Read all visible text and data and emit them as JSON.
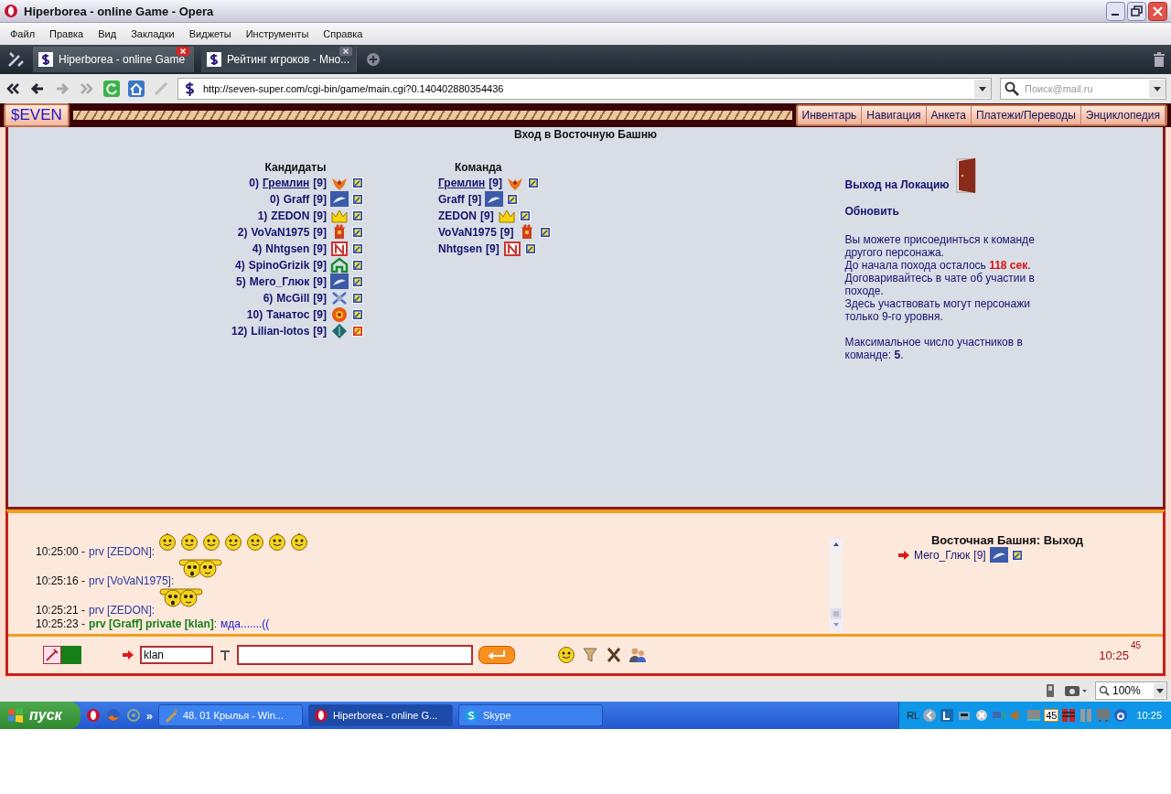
{
  "window": {
    "title": "Hiperborea - online Game - Opera"
  },
  "menu": [
    "Файл",
    "Правка",
    "Вид",
    "Закладки",
    "Виджеты",
    "Инструменты",
    "Справка"
  ],
  "tabs": [
    {
      "title": "Hiperborea - online Game",
      "selected": true
    },
    {
      "title": "Рейтинг игроков - Мно...",
      "selected": false
    }
  ],
  "address": {
    "url": "http://seven-super.com/cgi-bin/game/main.cgi?0.140402880354436"
  },
  "search": {
    "placeholder": "Поиск@mail.ru"
  },
  "game": {
    "logo": "$EVEN",
    "nav": [
      "Инвентарь",
      "Навигация",
      "Анкета",
      "Платежи/Переводы",
      "Энциклопедия"
    ],
    "heading": "Вход в Восточную Башню",
    "candidates": {
      "title": "Кандидаты",
      "rows": [
        {
          "rank": "0)",
          "name": "Гремлин",
          "level": "[9]",
          "link": true,
          "kind": "phoenix",
          "flagged": false
        },
        {
          "rank": "0)",
          "name": "Graff",
          "level": "[9]",
          "link": false,
          "kind": "dolphin",
          "flagged": false
        },
        {
          "rank": "1)",
          "name": "ZEDON",
          "level": "[9]",
          "link": false,
          "kind": "crown",
          "flagged": false
        },
        {
          "rank": "2)",
          "name": "VoVaN1975",
          "level": "[9]",
          "link": false,
          "kind": "tower",
          "flagged": false
        },
        {
          "rank": "4)",
          "name": "Nhtgsen",
          "level": "[9]",
          "link": false,
          "kind": "banner",
          "flagged": false
        },
        {
          "rank": "4)",
          "name": "SpinoGrizik",
          "level": "[9]",
          "link": false,
          "kind": "arch",
          "flagged": false
        },
        {
          "rank": "5)",
          "name": "Мего_Глюк",
          "level": "[9]",
          "link": false,
          "kind": "dolphin",
          "flagged": false
        },
        {
          "rank": "6)",
          "name": "McGill",
          "level": "[9]",
          "link": false,
          "kind": "cross",
          "flagged": false
        },
        {
          "rank": "10)",
          "name": "Танатос",
          "level": "[9]",
          "link": false,
          "kind": "fire",
          "flagged": false
        },
        {
          "rank": "12)",
          "name": "Lilian-lotos",
          "level": "[9]",
          "link": false,
          "kind": "gem",
          "flagged": true
        }
      ]
    },
    "team": {
      "title": "Команда",
      "rows": [
        {
          "name": "Гремлин",
          "level": "[9]",
          "link": true,
          "kind": "phoenix"
        },
        {
          "name": "Graff",
          "level": "[9]",
          "link": false,
          "kind": "dolphin"
        },
        {
          "name": "ZEDON",
          "level": "[9]",
          "link": false,
          "kind": "crown"
        },
        {
          "name": "VoVaN1975",
          "level": "[9]",
          "link": false,
          "kind": "tower"
        },
        {
          "name": "Nhtgsen",
          "level": "[9]",
          "link": false,
          "kind": "banner"
        }
      ]
    },
    "side": {
      "exit_link": "Выход на Локацию",
      "refresh_link": "Обновить",
      "info": [
        "Вы можете присоединться к команде другого персонажа.",
        "До начала похода осталось **118 сек**.",
        "Договаривайтесь в чате об участии в походе.",
        "Здесь участвовать могут персонажи только 9-го уровня."
      ],
      "max_note": "Максимальное число участников в команде: **5**."
    },
    "chat": {
      "messages": [
        {
          "time": "10:25:00 -",
          "sender": "prv [ZEDON]",
          "separator": ":",
          "private": false,
          "kind": "smileys"
        },
        {
          "time": "10:25:16 -",
          "sender": "prv [VoVaN1975]",
          "separator": ":",
          "private": false,
          "kind": "pair"
        },
        {
          "time": "10:25:21 -",
          "sender": "prv [ZEDON]",
          "separator": ":",
          "private": false,
          "kind": "pair"
        },
        {
          "time": "10:25:23 -",
          "sender": "prv [Graff] private [klan]",
          "separator": ":",
          "text": "мда.......((",
          "private": true,
          "kind": "text"
        }
      ],
      "location": {
        "title": "Восточная Башня: Выход",
        "players": [
          {
            "name": "Мего_Глюк",
            "level": "[9]",
            "kind": "dolphin"
          }
        ]
      },
      "channel": "klan",
      "clock": "10:25",
      "seconds": "45"
    }
  },
  "status_bar": {
    "zoom": "100%"
  },
  "taskbar": {
    "start": "пуск",
    "more": "»",
    "tasks": [
      {
        "title": "48. 01 Крылья - Win...",
        "selected": false
      },
      {
        "title": "Hiperborea - online G...",
        "selected": true
      },
      {
        "title": "Skype",
        "selected": false
      }
    ],
    "tray_label": "RL",
    "tray_badge": "45",
    "clock": "10:25"
  }
}
